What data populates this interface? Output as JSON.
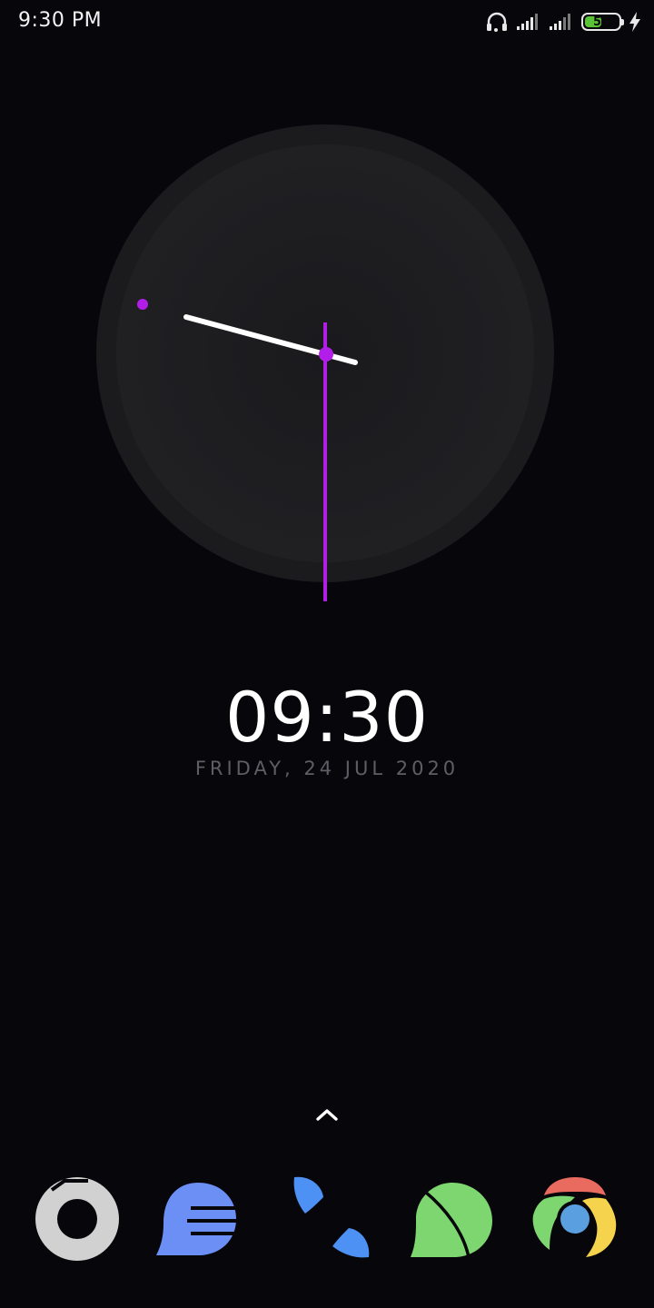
{
  "status_bar": {
    "time": "9:30 PM",
    "battery_level": "55",
    "battery_fraction": 0.55,
    "icons": [
      "headset-icon",
      "signal-icon",
      "signal-icon",
      "battery-icon",
      "charging-bolt-icon"
    ]
  },
  "clock": {
    "digital_time": "09:30",
    "date": "FRIDAY, 24 JUL 2020",
    "accent_color": "#b21ee8",
    "face_color": "#1f1f22"
  },
  "dock": {
    "apps": [
      {
        "icon": "camera-icon",
        "color": "#d1d1d1"
      },
      {
        "icon": "messages-icon",
        "color": "#6b8ff5"
      },
      {
        "icon": "phone-icon",
        "color": "#4d91f5"
      },
      {
        "icon": "browser-icon",
        "color": "#7ed670"
      },
      {
        "icon": "chrome-icon",
        "color": "#5aa0e0"
      }
    ]
  }
}
